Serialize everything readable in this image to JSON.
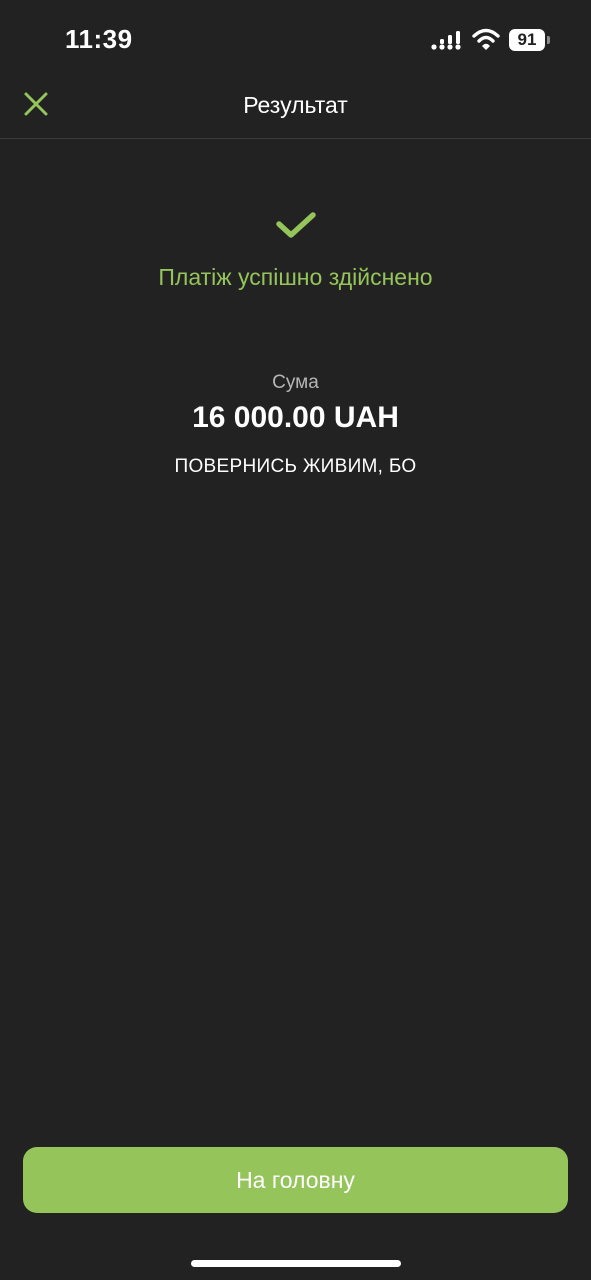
{
  "status_bar": {
    "time": "11:39",
    "battery_level": "91",
    "icons": [
      "signal-icon",
      "wifi-icon",
      "battery-icon"
    ]
  },
  "header": {
    "title": "Результат",
    "close_icon": "close-icon"
  },
  "result": {
    "status_icon": "checkmark-icon",
    "message": "Платіж успішно здійснено",
    "amount_label": "Сума",
    "amount_value": "16 000.00 UAH",
    "purpose": "ПОВЕРНИСЬ ЖИВИМ, БО"
  },
  "actions": {
    "home_label": "На головну"
  },
  "colors": {
    "background": "#222222",
    "accent": "#94c45a",
    "text_primary": "#ffffff",
    "text_secondary": "#b5b5b5"
  }
}
